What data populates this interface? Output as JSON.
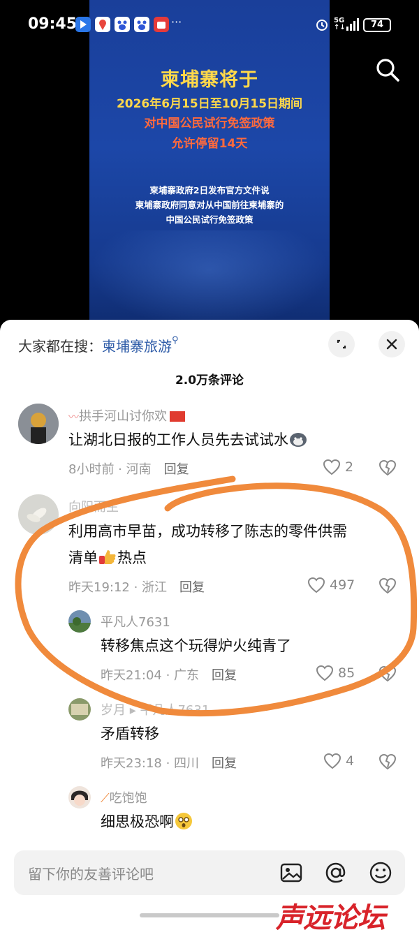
{
  "status_bar": {
    "time": "09:45",
    "network": "5G",
    "battery": "74"
  },
  "video": {
    "title": "柬埔寨将于",
    "line1": "2026年6月15日至10月15日期间",
    "line2": "对中国公民试行免签政策",
    "line3": "允许停留14天",
    "small1": "柬埔寨政府2日发布官方文件说",
    "small2": "柬埔寨政府同意对从中国前往柬埔寨的",
    "small3": "中国公民试行免签政策"
  },
  "sheet": {
    "suggest_label": "大家都在搜：",
    "suggest_keyword": "柬埔寨旅游",
    "comment_count": "2.0万条评论",
    "reply_label": "回复",
    "comments": [
      {
        "user": "拱手河山讨你欢",
        "text": "让湖北日报的工作人员先去试试水",
        "time_place": "8小时前 · 河南",
        "likes": "2"
      },
      {
        "user": "向阳而生",
        "text_line1": "利用高市早苗，成功转移了陈志的零件供需",
        "text_line2": "清单",
        "text_tail": "热点",
        "time_place": "昨天19:12 · 浙江",
        "likes": "497"
      },
      {
        "user": "平凡人7631",
        "text": "转移焦点这个玩得炉火纯青了",
        "time_place": "昨天21:04 · 广东",
        "likes": "85"
      },
      {
        "user": "岁月 ▸ 平凡人7631",
        "text": "矛盾转移",
        "time_place": "昨天23:18 · 四川",
        "likes": "4"
      },
      {
        "user": "吃饱饱",
        "text": "细思极恐啊"
      }
    ],
    "input_placeholder": "留下你的友善评论吧"
  },
  "watermark": "声远论坛",
  "colors": {
    "accent": "#2f5ca8",
    "scribble": "#f08a3c",
    "poster_blue": "#1c47a8"
  }
}
